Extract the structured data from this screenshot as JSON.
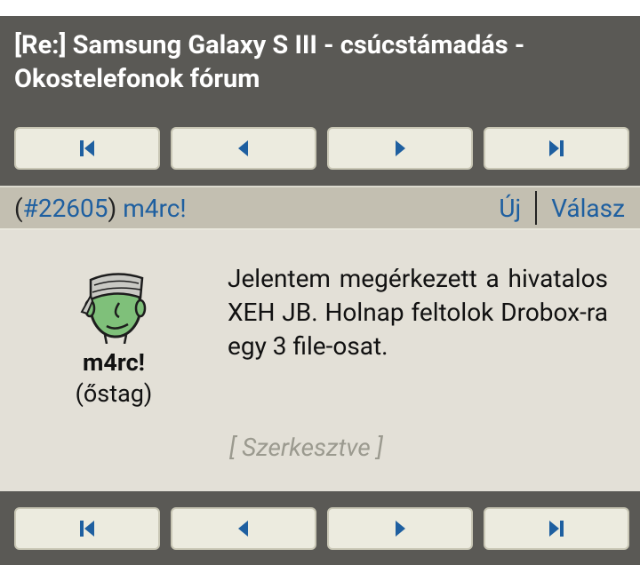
{
  "page": {
    "title": "[Re:] Samsung Galaxy S III - csúcstámadás - Okostelefonok fórum"
  },
  "nav": {
    "buttons": [
      {
        "name": "first-page",
        "icon": "skip-first-icon"
      },
      {
        "name": "prev-page",
        "icon": "prev-icon"
      },
      {
        "name": "next-page",
        "icon": "next-icon"
      },
      {
        "name": "last-page",
        "icon": "skip-last-icon"
      }
    ]
  },
  "post": {
    "number": "#22605",
    "author": "m4rc!",
    "new_label": "Új",
    "reply_label": "Válasz",
    "author_rank": "(őstag)",
    "text": "Jelentem megérkezett a hivatalos XEH JB. Holnap feltolok Drobox-ra egy 3 file-osat.",
    "edited_label": "[ Szerkesztve ]"
  },
  "colors": {
    "header_bg": "#5a5955",
    "bar_bg": "#c3bfb1",
    "post_bg": "#e3e0d7",
    "link": "#1e5fa0",
    "icon": "#1e5fa0"
  }
}
